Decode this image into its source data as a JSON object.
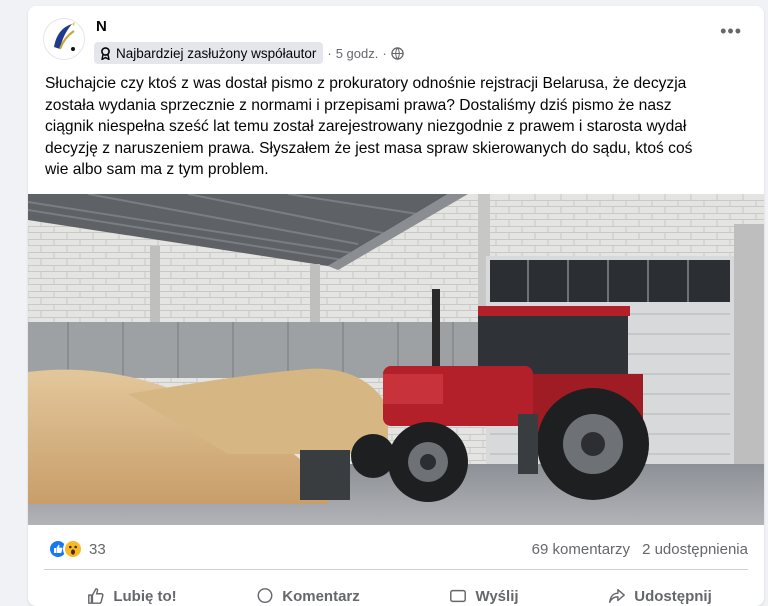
{
  "post": {
    "author_initial": "N",
    "badge_text": "Najbardziej zasłużony współautor",
    "time": "5 godz.",
    "text": "Słuchajcie czy ktoś z was dostał pismo z prokuratory odnośnie  rejstracji Belarusa, że  decyzja\nzostała wydania sprzecznie z normami  i przepisami prawa? Dostaliśmy dziś pismo że  nasz\nciągnik niespełna sześć lat temu został zarejestrowany niezgodnie z prawem i starosta wydał\ndecyzję z naruszeniem prawa. Słyszałem że jest masa spraw skierowanych do sądu, ktoś coś\nwie albo sam ma z tym problem.",
    "image_alt": "Czerwony ciągnik Belarus w hali magazynowej ze zbożem"
  },
  "stats": {
    "reaction_count": "33",
    "comments": "69 komentarzy",
    "shares": "2 udostępnienia"
  },
  "actions": {
    "like": "Lubię to!",
    "comment": "Komentarz",
    "share": "Wyślij",
    "repost": "Udostępnij"
  },
  "icons": {
    "badge": "award-ribbon-icon",
    "audience": "globe-icon",
    "more": "more-horizontal-icon",
    "like": "thumbs-up-icon",
    "wow": "wow-emoji-icon"
  },
  "colors": {
    "accent": "#1877f2",
    "tractor": "#b3202a",
    "grain": "#d9b98a"
  }
}
